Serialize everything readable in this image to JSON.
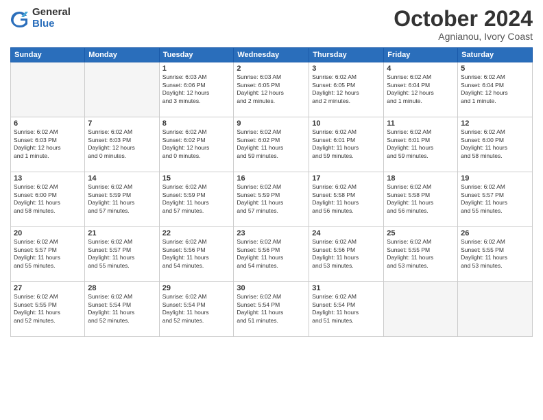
{
  "logo": {
    "general": "General",
    "blue": "Blue"
  },
  "header": {
    "month": "October 2024",
    "location": "Agnianou, Ivory Coast"
  },
  "weekdays": [
    "Sunday",
    "Monday",
    "Tuesday",
    "Wednesday",
    "Thursday",
    "Friday",
    "Saturday"
  ],
  "weeks": [
    [
      {
        "day": "",
        "info": ""
      },
      {
        "day": "",
        "info": ""
      },
      {
        "day": "1",
        "info": "Sunrise: 6:03 AM\nSunset: 6:06 PM\nDaylight: 12 hours\nand 3 minutes."
      },
      {
        "day": "2",
        "info": "Sunrise: 6:03 AM\nSunset: 6:05 PM\nDaylight: 12 hours\nand 2 minutes."
      },
      {
        "day": "3",
        "info": "Sunrise: 6:02 AM\nSunset: 6:05 PM\nDaylight: 12 hours\nand 2 minutes."
      },
      {
        "day": "4",
        "info": "Sunrise: 6:02 AM\nSunset: 6:04 PM\nDaylight: 12 hours\nand 1 minute."
      },
      {
        "day": "5",
        "info": "Sunrise: 6:02 AM\nSunset: 6:04 PM\nDaylight: 12 hours\nand 1 minute."
      }
    ],
    [
      {
        "day": "6",
        "info": "Sunrise: 6:02 AM\nSunset: 6:03 PM\nDaylight: 12 hours\nand 1 minute."
      },
      {
        "day": "7",
        "info": "Sunrise: 6:02 AM\nSunset: 6:03 PM\nDaylight: 12 hours\nand 0 minutes."
      },
      {
        "day": "8",
        "info": "Sunrise: 6:02 AM\nSunset: 6:02 PM\nDaylight: 12 hours\nand 0 minutes."
      },
      {
        "day": "9",
        "info": "Sunrise: 6:02 AM\nSunset: 6:02 PM\nDaylight: 11 hours\nand 59 minutes."
      },
      {
        "day": "10",
        "info": "Sunrise: 6:02 AM\nSunset: 6:01 PM\nDaylight: 11 hours\nand 59 minutes."
      },
      {
        "day": "11",
        "info": "Sunrise: 6:02 AM\nSunset: 6:01 PM\nDaylight: 11 hours\nand 59 minutes."
      },
      {
        "day": "12",
        "info": "Sunrise: 6:02 AM\nSunset: 6:00 PM\nDaylight: 11 hours\nand 58 minutes."
      }
    ],
    [
      {
        "day": "13",
        "info": "Sunrise: 6:02 AM\nSunset: 6:00 PM\nDaylight: 11 hours\nand 58 minutes."
      },
      {
        "day": "14",
        "info": "Sunrise: 6:02 AM\nSunset: 5:59 PM\nDaylight: 11 hours\nand 57 minutes."
      },
      {
        "day": "15",
        "info": "Sunrise: 6:02 AM\nSunset: 5:59 PM\nDaylight: 11 hours\nand 57 minutes."
      },
      {
        "day": "16",
        "info": "Sunrise: 6:02 AM\nSunset: 5:59 PM\nDaylight: 11 hours\nand 57 minutes."
      },
      {
        "day": "17",
        "info": "Sunrise: 6:02 AM\nSunset: 5:58 PM\nDaylight: 11 hours\nand 56 minutes."
      },
      {
        "day": "18",
        "info": "Sunrise: 6:02 AM\nSunset: 5:58 PM\nDaylight: 11 hours\nand 56 minutes."
      },
      {
        "day": "19",
        "info": "Sunrise: 6:02 AM\nSunset: 5:57 PM\nDaylight: 11 hours\nand 55 minutes."
      }
    ],
    [
      {
        "day": "20",
        "info": "Sunrise: 6:02 AM\nSunset: 5:57 PM\nDaylight: 11 hours\nand 55 minutes."
      },
      {
        "day": "21",
        "info": "Sunrise: 6:02 AM\nSunset: 5:57 PM\nDaylight: 11 hours\nand 55 minutes."
      },
      {
        "day": "22",
        "info": "Sunrise: 6:02 AM\nSunset: 5:56 PM\nDaylight: 11 hours\nand 54 minutes."
      },
      {
        "day": "23",
        "info": "Sunrise: 6:02 AM\nSunset: 5:56 PM\nDaylight: 11 hours\nand 54 minutes."
      },
      {
        "day": "24",
        "info": "Sunrise: 6:02 AM\nSunset: 5:56 PM\nDaylight: 11 hours\nand 53 minutes."
      },
      {
        "day": "25",
        "info": "Sunrise: 6:02 AM\nSunset: 5:55 PM\nDaylight: 11 hours\nand 53 minutes."
      },
      {
        "day": "26",
        "info": "Sunrise: 6:02 AM\nSunset: 5:55 PM\nDaylight: 11 hours\nand 53 minutes."
      }
    ],
    [
      {
        "day": "27",
        "info": "Sunrise: 6:02 AM\nSunset: 5:55 PM\nDaylight: 11 hours\nand 52 minutes."
      },
      {
        "day": "28",
        "info": "Sunrise: 6:02 AM\nSunset: 5:54 PM\nDaylight: 11 hours\nand 52 minutes."
      },
      {
        "day": "29",
        "info": "Sunrise: 6:02 AM\nSunset: 5:54 PM\nDaylight: 11 hours\nand 52 minutes."
      },
      {
        "day": "30",
        "info": "Sunrise: 6:02 AM\nSunset: 5:54 PM\nDaylight: 11 hours\nand 51 minutes."
      },
      {
        "day": "31",
        "info": "Sunrise: 6:02 AM\nSunset: 5:54 PM\nDaylight: 11 hours\nand 51 minutes."
      },
      {
        "day": "",
        "info": ""
      },
      {
        "day": "",
        "info": ""
      }
    ]
  ]
}
